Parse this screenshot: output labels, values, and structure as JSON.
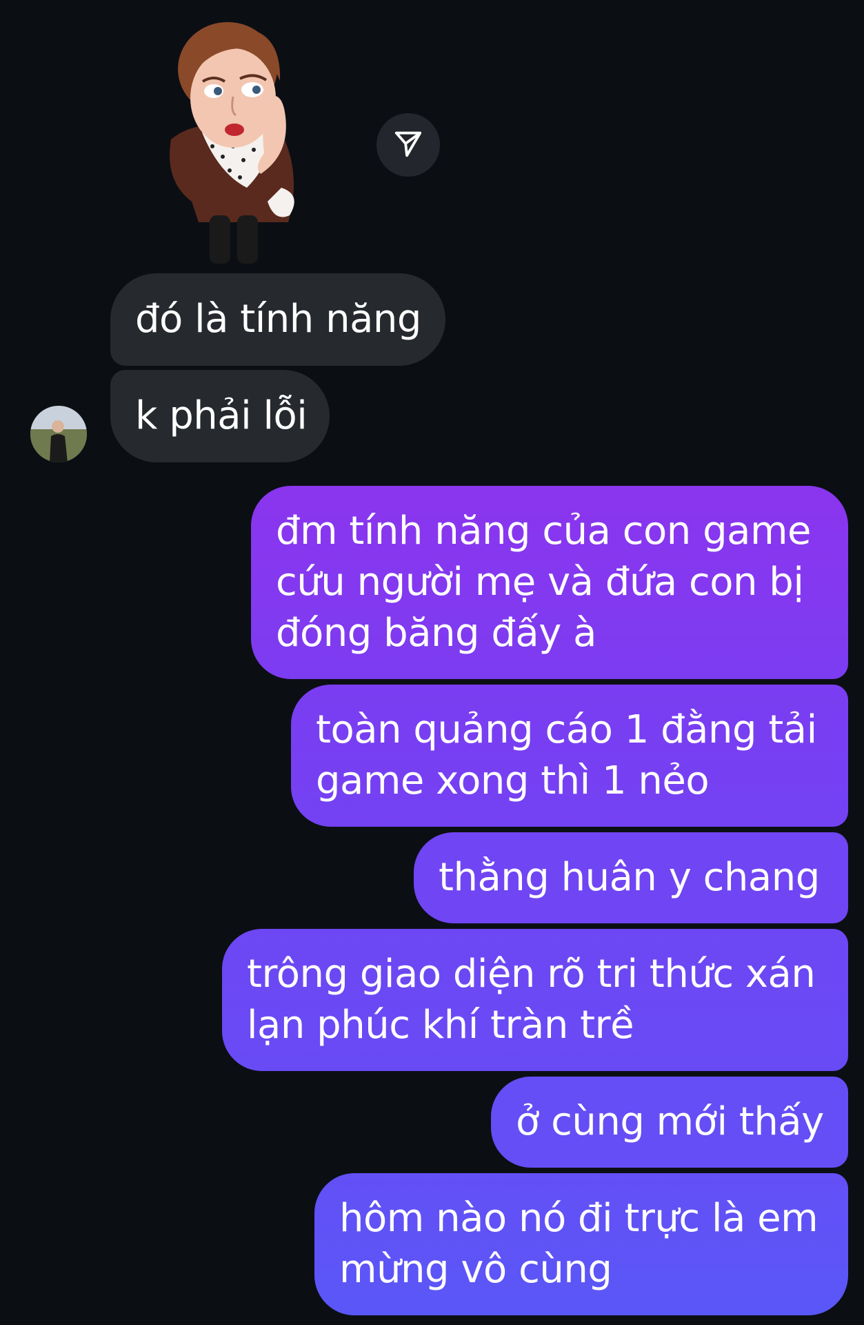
{
  "conversation": {
    "incoming": [
      {
        "text": "đó là tính năng"
      },
      {
        "text": "k phải lỗi"
      }
    ],
    "outgoing": [
      {
        "lines": [
          "đm tính năng của con game",
          "cứu người mẹ và đứa con bị",
          "đóng băng đấy à"
        ]
      },
      {
        "lines": [
          "toàn quảng cáo 1 đằng tải",
          "game xong thì 1 nẻo"
        ]
      },
      {
        "lines": [
          "thằng huân y chang"
        ]
      },
      {
        "lines": [
          "trông giao diện rõ tri thức xán",
          "lạn phúc khí tràn trề"
        ]
      },
      {
        "lines": [
          "ở cùng mới thấy"
        ]
      },
      {
        "lines": [
          "hôm nào nó đi trực là em",
          "mừng vô cùng"
        ]
      }
    ]
  },
  "icons": {
    "share": "send-icon",
    "avatar": "contact-avatar",
    "sticker": "thinking-woman-sticker"
  },
  "colors": {
    "background": "#0b0f14",
    "incoming_bubble": "#26292e",
    "outgoing_top": "#8b35ee",
    "outgoing_bottom": "#5a57f7"
  }
}
